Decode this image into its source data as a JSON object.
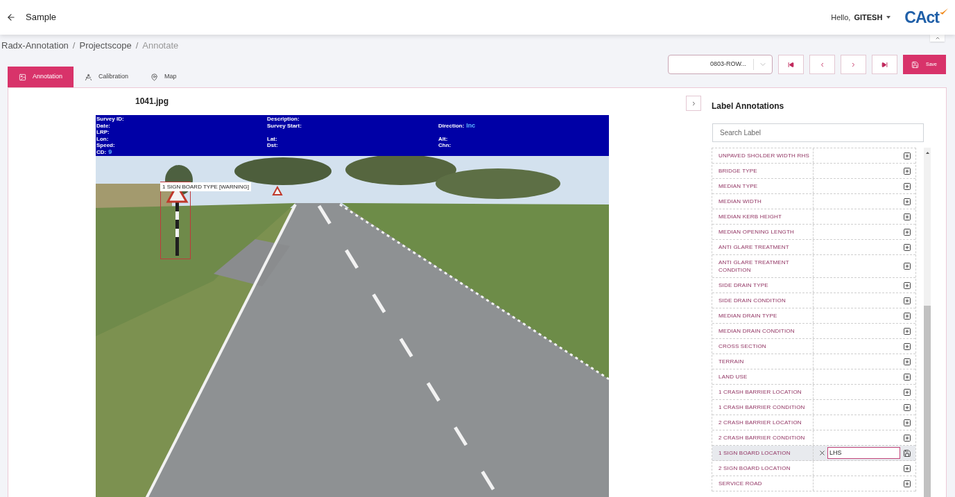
{
  "header": {
    "title": "Sample",
    "greeting": "Hello,",
    "user": "GITESH",
    "logo_text": "CAct"
  },
  "breadcrumb": [
    {
      "kind": "link",
      "text": "Radx-Annotation"
    },
    {
      "kind": "separator",
      "text": "/"
    },
    {
      "kind": "link",
      "text": "Projectscope"
    },
    {
      "kind": "separator",
      "text": "/"
    },
    {
      "kind": "current",
      "text": "Annotate"
    }
  ],
  "tabs": [
    {
      "label": "Annotation",
      "selected": true
    },
    {
      "label": "Calibration",
      "selected": false
    },
    {
      "label": "Map",
      "selected": false
    }
  ],
  "image_picker": {
    "value": "0803-ROW..."
  },
  "save_button": "Save",
  "viewer": {
    "file_name": "1041.jpg",
    "info_rows": [
      [
        {
          "label": "Survey ID:"
        },
        {
          "label": "Description:"
        },
        null
      ],
      [
        {
          "label": "Date:"
        },
        {
          "label": "Survey Start:"
        },
        {
          "label": "Direction:",
          "value": "Inc"
        }
      ],
      [
        {
          "label": "LRP:"
        },
        null,
        null
      ],
      [
        {
          "label": "Lon:"
        },
        {
          "label": "Lat:"
        },
        {
          "label": "Alt:"
        }
      ],
      [
        {
          "label": "Speed:"
        },
        {
          "label": "Dst:"
        },
        {
          "label": "Chn:"
        }
      ],
      [
        {
          "label": "CD:",
          "value": "9"
        },
        null,
        null
      ]
    ],
    "annotations": [
      {
        "label": "1 SIGN BOARD TYPE [WARNING]"
      }
    ]
  },
  "label_panel": {
    "title": "Label Annotations",
    "search": {
      "placeholder": "Search Label"
    },
    "rows": [
      {
        "label": "UNPAVED SHOLDER WIDTH RHS",
        "selected": false
      },
      {
        "label": "BRIDGE TYPE",
        "selected": false
      },
      {
        "label": "MEDIAN TYPE",
        "selected": false
      },
      {
        "label": "MEDIAN WIDTH",
        "selected": false
      },
      {
        "label": "MEDIAN KERB HEIGHT",
        "selected": false
      },
      {
        "label": "MEDIAN OPENING LENGTH",
        "selected": false
      },
      {
        "label": "ANTI GLARE TREATMENT",
        "selected": false
      },
      {
        "label": "ANTI GLARE TREATMENT CONDITION",
        "selected": false
      },
      {
        "label": "SIDE DRAIN TYPE",
        "selected": false
      },
      {
        "label": "SIDE DRAIN CONDITION",
        "selected": false
      },
      {
        "label": "MEDIAN DRAIN TYPE",
        "selected": false
      },
      {
        "label": "MEDIAN DRAIN CONDITION",
        "selected": false
      },
      {
        "label": "CROSS SECTION",
        "selected": false
      },
      {
        "label": "TERRAIN",
        "selected": false
      },
      {
        "label": "LAND USE",
        "selected": false
      },
      {
        "label": "1 CRASH BARRIER LOCATION",
        "selected": false
      },
      {
        "label": "1 CRASH BARRIER CONDITION",
        "selected": false
      },
      {
        "label": "2 CRASH BARRIER LOCATION",
        "selected": false
      },
      {
        "label": "2 CRASH BARRIER CONDITION",
        "selected": false
      },
      {
        "label": "1 SIGN BOARD LOCATION",
        "selected": true,
        "value": "LHS"
      },
      {
        "label": "2 SIGN BOARD LOCATION",
        "selected": false
      },
      {
        "label": "SERVICE ROAD",
        "selected": false
      }
    ]
  }
}
